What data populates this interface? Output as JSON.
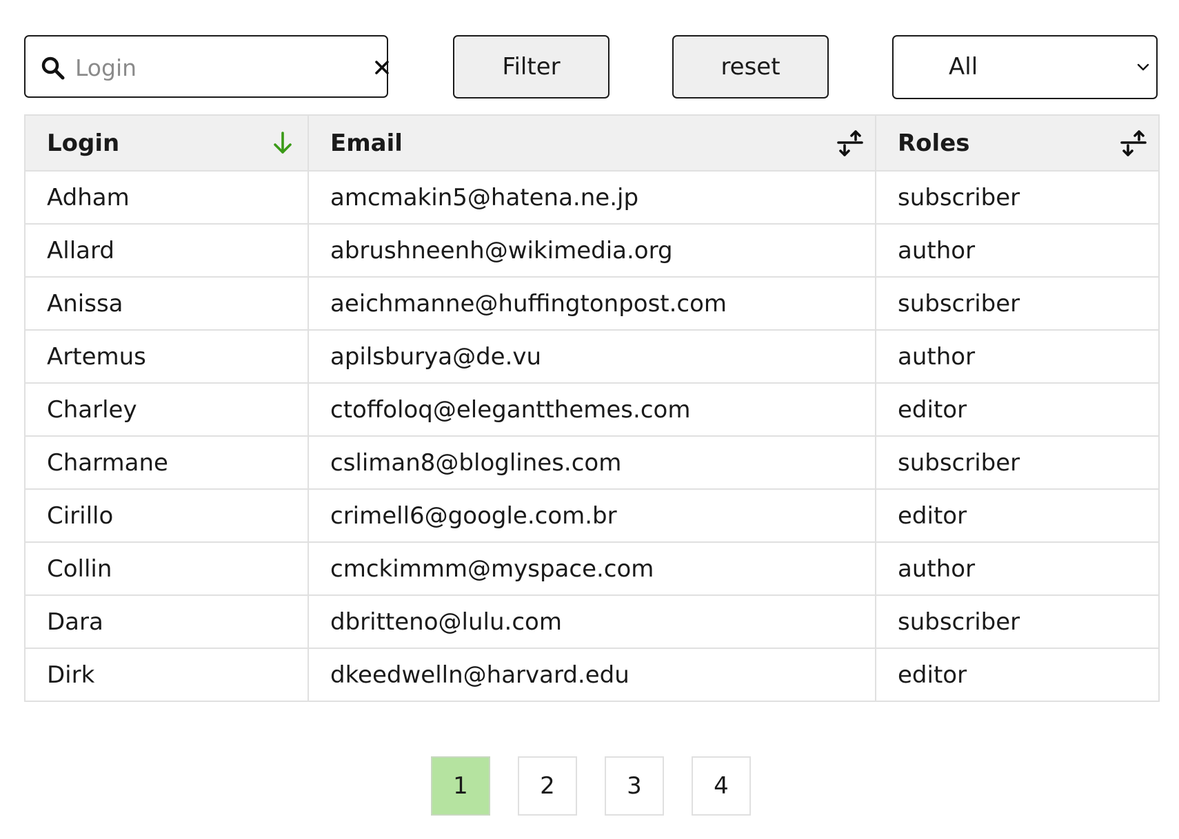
{
  "search": {
    "placeholder": "Login",
    "value": ""
  },
  "toolbar": {
    "filter_label": "Filter",
    "reset_label": "reset",
    "role_select": {
      "selected": "All"
    }
  },
  "table": {
    "columns": [
      {
        "label": "Login",
        "sort": "descending-arrow",
        "sort_icon": "arrow-down-icon"
      },
      {
        "label": "Email",
        "sort": "unsorted",
        "sort_icon": "sort-icon"
      },
      {
        "label": "Roles",
        "sort": "unsorted",
        "sort_icon": "sort-icon"
      }
    ],
    "rows": [
      {
        "login": "Adham",
        "email": "amcmakin5@hatena.ne.jp",
        "role": "subscriber"
      },
      {
        "login": "Allard",
        "email": "abrushneenh@wikimedia.org",
        "role": "author"
      },
      {
        "login": "Anissa",
        "email": "aeichmanne@huffingtonpost.com",
        "role": "subscriber"
      },
      {
        "login": "Artemus",
        "email": "apilsburya@de.vu",
        "role": "author"
      },
      {
        "login": "Charley",
        "email": "ctoffoloq@elegantthemes.com",
        "role": "editor"
      },
      {
        "login": "Charmane",
        "email": "csliman8@bloglines.com",
        "role": "subscriber"
      },
      {
        "login": "Cirillo",
        "email": "crimell6@google.com.br",
        "role": "editor"
      },
      {
        "login": "Collin",
        "email": "cmckimmm@myspace.com",
        "role": "author"
      },
      {
        "login": "Dara",
        "email": "dbritteno@lulu.com",
        "role": "subscriber"
      },
      {
        "login": "Dirk",
        "email": "dkeedwelln@harvard.edu",
        "role": "editor"
      }
    ]
  },
  "pagination": {
    "pages": [
      "1",
      "2",
      "3",
      "4"
    ],
    "current": "1"
  },
  "colors": {
    "active_page": "#b5e3a0",
    "sort_active": "#3a9a17",
    "header_bg": "#f0f0f0",
    "border": "#e0e0e0"
  }
}
